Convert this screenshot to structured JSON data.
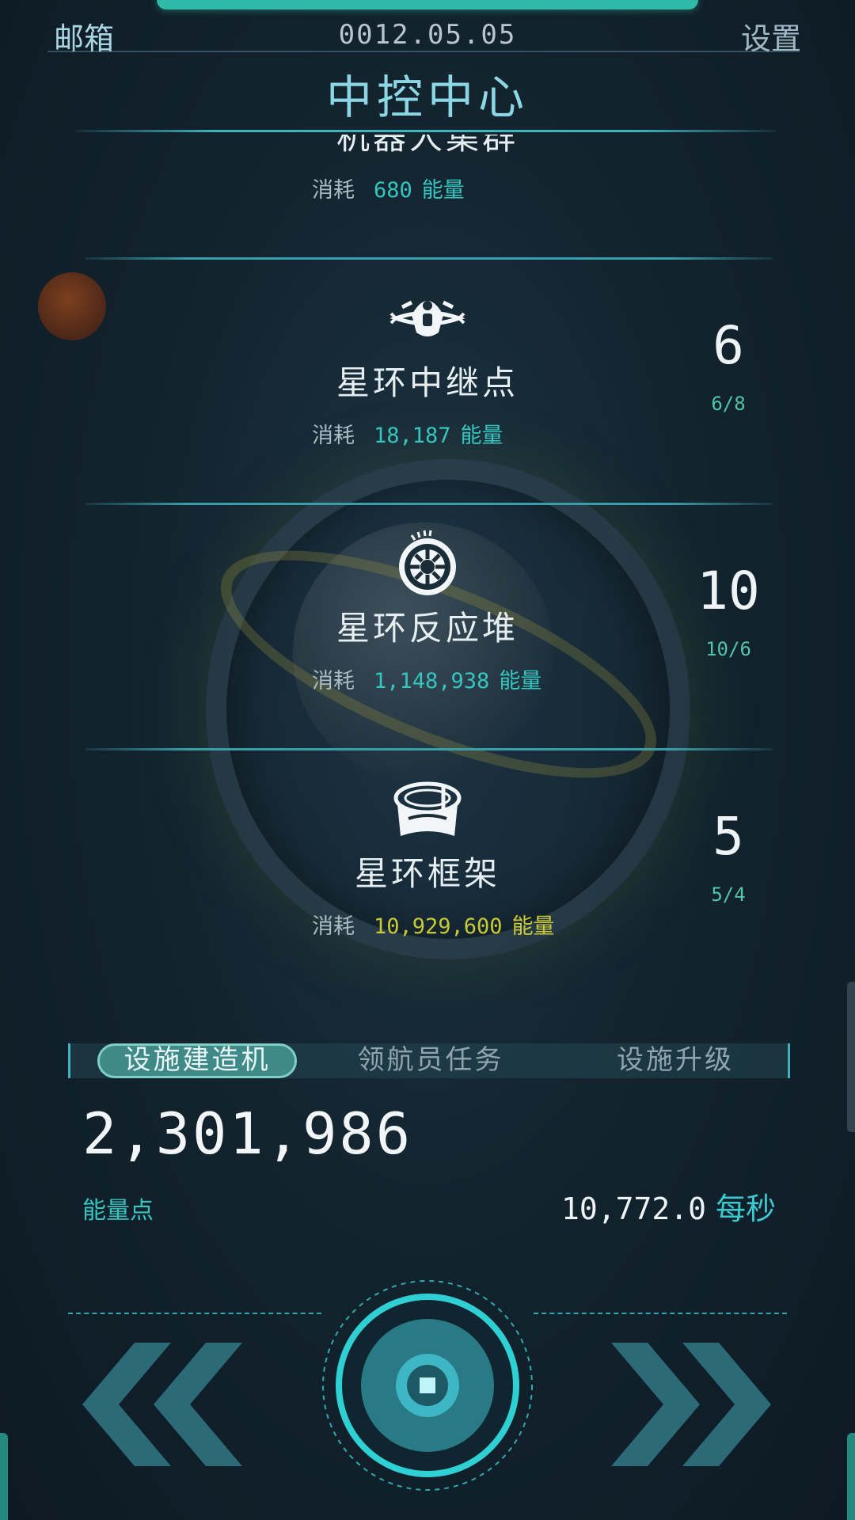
{
  "header": {
    "mail_label": "邮箱",
    "date": "0012.05.05",
    "settings_label": "设置",
    "title": "中控中心"
  },
  "items": [
    {
      "name": "机器人集群",
      "cost_label": "消耗",
      "cost": "680",
      "cost_unit": "能量"
    },
    {
      "name": "星环中继点",
      "cost_label": "消耗",
      "cost": "18,187",
      "cost_unit": "能量",
      "count": "6",
      "ratio": "6/8",
      "icon": "relay-station-icon"
    },
    {
      "name": "星环反应堆",
      "cost_label": "消耗",
      "cost": "1,148,938",
      "cost_unit": "能量",
      "count": "10",
      "ratio": "10/6",
      "icon": "reactor-icon"
    },
    {
      "name": "星环框架",
      "cost_label": "消耗",
      "cost": "10,929,600",
      "cost_unit": "能量",
      "count": "5",
      "ratio": "5/4",
      "icon": "ring-frame-icon"
    }
  ],
  "tabs": [
    {
      "label": "设施建造机",
      "active": true
    },
    {
      "label": "领航员任务",
      "active": false
    },
    {
      "label": "设施升级",
      "active": false
    }
  ],
  "energy": {
    "total": "2,301,986",
    "label": "能量点",
    "rate": "10,772.0",
    "rate_unit": "每秒"
  },
  "colors": {
    "accent": "#35c6c0",
    "title": "#8cd7e6",
    "expensive_cost": "#c9c935",
    "ratio": "#4fc6a8",
    "background": "#0f1e29"
  },
  "controls": {
    "left_icon": "double-chevron-left-icon",
    "center_icon": "stop-icon",
    "right_icon": "double-chevron-right-icon"
  }
}
